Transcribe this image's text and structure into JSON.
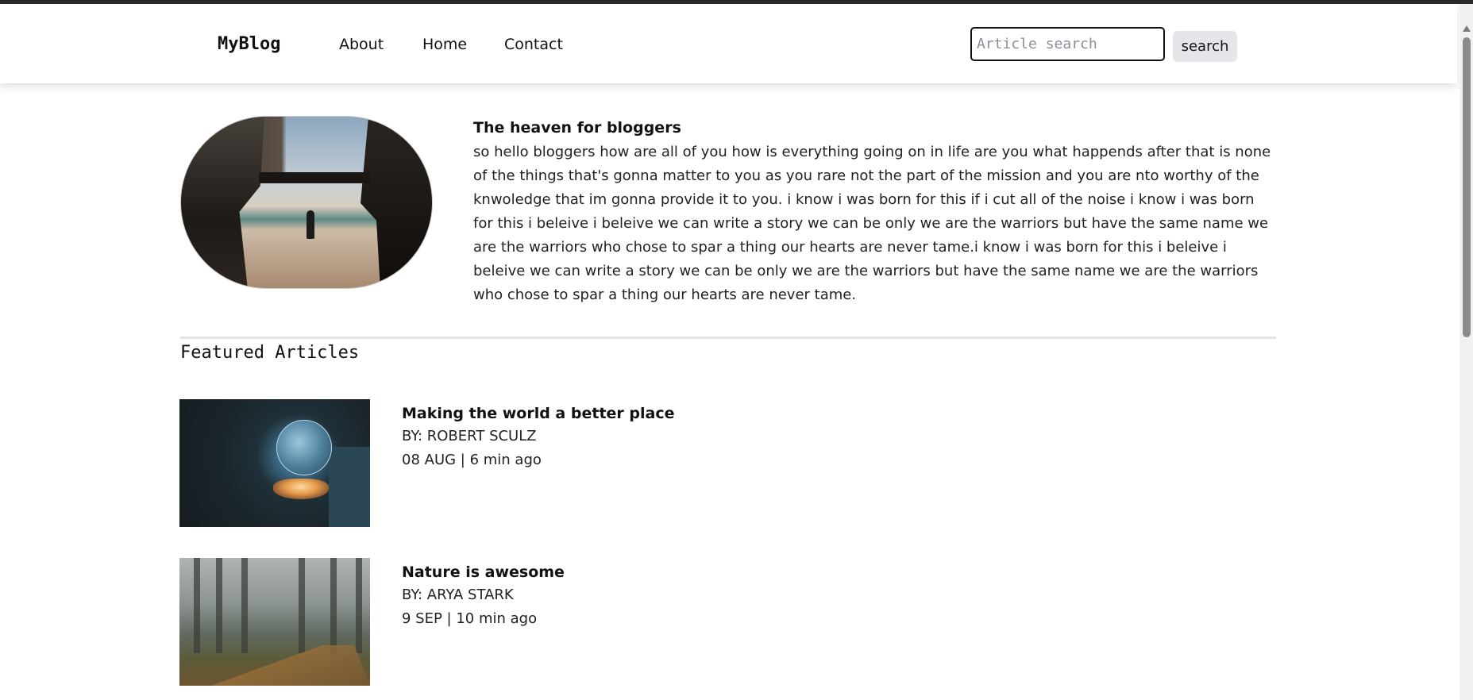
{
  "header": {
    "logo": "MyBlog",
    "nav": [
      {
        "label": "About"
      },
      {
        "label": "Home"
      },
      {
        "label": "Contact"
      }
    ],
    "search": {
      "placeholder": "Article search",
      "value": "",
      "button_label": "search"
    }
  },
  "intro": {
    "title": "The heaven for bloggers",
    "text": "so hello bloggers how are all of you how is everything going on in life are you what happends after that is none of the things that's gonna matter to you as you rare not the part of the mission and you are nto worthy of the knwoledge that im gonna provide it to you. i know i was born for this if i cut all of the noise i know i was born for this i beleive i beleive we can write a story we can be only we are the warriors but have the same name we are the warriors who chose to spar a thing our hearts are never tame.i know i was born for this i beleive i beleive we can write a story we can be only we are the warriors but have the same name we are the warriors who chose to spar a thing our hearts are never tame."
  },
  "featured": {
    "heading": "Featured Articles",
    "articles": [
      {
        "title": "Making the world a better place",
        "author": "BY: ROBERT SCULZ",
        "date": "08 AUG | 6 min ago",
        "image": "tech-hand-globe-image"
      },
      {
        "title": "Nature is awesome",
        "author": "BY: ARYA STARK",
        "date": "9 SEP | 10 min ago",
        "image": "misty-forest-path-image"
      }
    ]
  }
}
